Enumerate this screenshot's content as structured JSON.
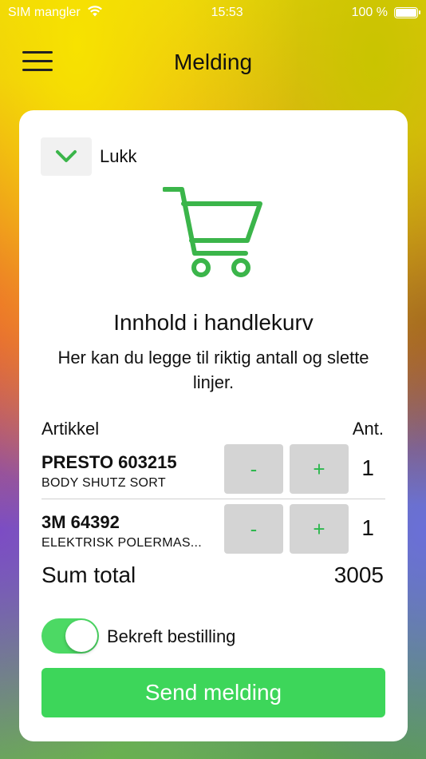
{
  "status_bar": {
    "carrier": "SIM mangler",
    "time": "15:53",
    "battery": "100 %",
    "battery_level": 1.0
  },
  "nav": {
    "title": "Melding",
    "menu_icon": "hamburger-menu-icon"
  },
  "card": {
    "close_label": "Lukk",
    "close_icon": "chevron-down-icon",
    "cart_icon": "shopping-cart-icon",
    "heading": "Innhold i handlekurv",
    "subtext": "Her kan du legge til riktig antall og slette linjer.",
    "columns": {
      "article": "Artikkel",
      "quantity": "Ant."
    },
    "items": [
      {
        "name": "PRESTO 603215",
        "description": "BODY SHUTZ SORT",
        "minus": "-",
        "plus": "+",
        "quantity": "1"
      },
      {
        "name": "3M 64392",
        "description": "ELEKTRISK POLERMAS...",
        "minus": "-",
        "plus": "+",
        "quantity": "1"
      }
    ],
    "sum_label": "Sum total",
    "sum_value": "3005",
    "confirm_label": "Bekreft bestilling",
    "confirm_on": true,
    "send_label": "Send melding"
  },
  "colors": {
    "accent_green": "#3dd65a",
    "toggle_green": "#4cd964",
    "icon_green": "#3bb54a"
  }
}
